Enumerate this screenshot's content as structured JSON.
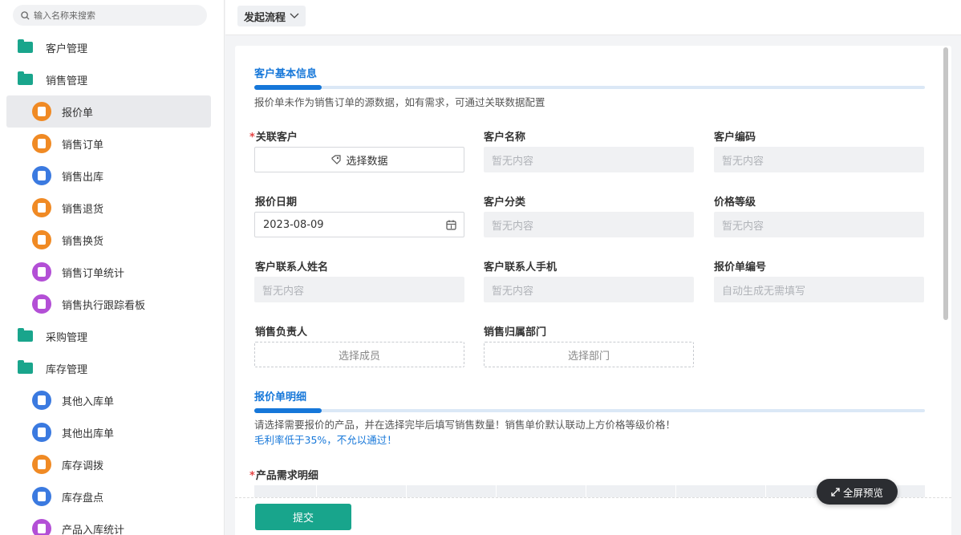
{
  "sidebar": {
    "search_placeholder": "输入名称来搜索",
    "items": [
      {
        "label": "客户管理",
        "kind": "group"
      },
      {
        "label": "销售管理",
        "kind": "group"
      },
      {
        "label": "报价单",
        "kind": "child",
        "color": "#f08a24",
        "active": true
      },
      {
        "label": "销售订单",
        "kind": "child",
        "color": "#f08a24"
      },
      {
        "label": "销售出库",
        "kind": "child",
        "color": "#3b7ae0"
      },
      {
        "label": "销售退货",
        "kind": "child",
        "color": "#f08a24"
      },
      {
        "label": "销售换货",
        "kind": "child",
        "color": "#f08a24"
      },
      {
        "label": "销售订单统计",
        "kind": "child",
        "color": "#b34fd6"
      },
      {
        "label": "销售执行跟踪看板",
        "kind": "child",
        "color": "#b34fd6"
      },
      {
        "label": "采购管理",
        "kind": "group"
      },
      {
        "label": "库存管理",
        "kind": "group"
      },
      {
        "label": "其他入库单",
        "kind": "child",
        "color": "#3b7ae0"
      },
      {
        "label": "其他出库单",
        "kind": "child",
        "color": "#3b7ae0"
      },
      {
        "label": "库存调拨",
        "kind": "child",
        "color": "#f08a24"
      },
      {
        "label": "库存盘点",
        "kind": "child",
        "color": "#3b7ae0"
      },
      {
        "label": "产品入库统计",
        "kind": "child",
        "color": "#b34fd6"
      }
    ]
  },
  "topbar": {
    "flow_button": "发起流程"
  },
  "form": {
    "section1": {
      "title": "客户基本信息",
      "hint": "报价单未作为销售订单的源数据，如有需求，可通过关联数据配置"
    },
    "fields": {
      "related_customer": {
        "label": "关联客户",
        "required": "*",
        "button": "选择数据"
      },
      "customer_name": {
        "label": "客户名称",
        "value": "暂无内容"
      },
      "customer_code": {
        "label": "客户编码",
        "value": "暂无内容"
      },
      "quote_date": {
        "label": "报价日期",
        "value": "2023-08-09"
      },
      "customer_category": {
        "label": "客户分类",
        "value": "暂无内容"
      },
      "price_level": {
        "label": "价格等级",
        "value": "暂无内容"
      },
      "contact_name": {
        "label": "客户联系人姓名",
        "value": "暂无内容"
      },
      "contact_phone": {
        "label": "客户联系人手机",
        "value": "暂无内容"
      },
      "quote_number": {
        "label": "报价单编号",
        "value": "自动生成无需填写"
      },
      "sales_owner": {
        "label": "销售负责人",
        "button": "选择成员"
      },
      "sales_dept": {
        "label": "销售归属部门",
        "button": "选择部门"
      }
    },
    "section2": {
      "title": "报价单明细",
      "hint": "请选择需要报价的产品，并在选择完毕后填写销售数量！销售单价默认联动上方价格等级价格！",
      "hint_blue": "毛利率低于35%，不允以通过！"
    },
    "product_detail": {
      "label": "产品需求明细",
      "required": "*"
    },
    "submit": "提交",
    "preview": "全屏预览"
  },
  "colors": {
    "accent": "#1677d9",
    "primary_green": "#18a58c",
    "folder": "#19a58c"
  }
}
